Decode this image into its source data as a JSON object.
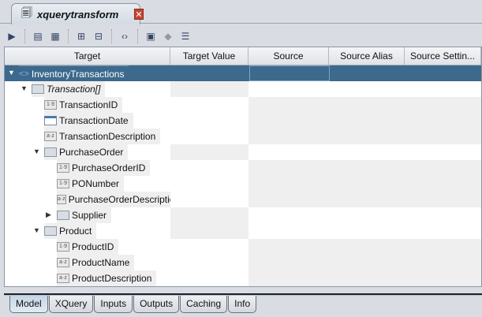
{
  "tab": {
    "title": "xquerytransform",
    "close": "✕"
  },
  "columns": [
    "Target",
    "Target Value",
    "Source",
    "Source Alias",
    "Source Settin..."
  ],
  "rows": [
    {
      "label": "InventoryTransactions",
      "icon": "<>",
      "level": 0,
      "expanded": true,
      "container": true,
      "selected": true
    },
    {
      "label": "Transaction[]",
      "icon": "box",
      "level": 1,
      "expanded": true,
      "container": true,
      "italic": true
    },
    {
      "label": "TransactionID",
      "icon": "1·9",
      "level": 2
    },
    {
      "label": "TransactionDate",
      "icon": "cal",
      "level": 2
    },
    {
      "label": "TransactionDescription",
      "icon": "a·z",
      "level": 2
    },
    {
      "label": "PurchaseOrder",
      "icon": "box",
      "level": 2,
      "expanded": true,
      "container": true
    },
    {
      "label": "PurchaseOrderID",
      "icon": "1·9",
      "level": 3
    },
    {
      "label": "PONumber",
      "icon": "1·9",
      "level": 3
    },
    {
      "label": "PurchaseOrderDescription",
      "icon": "a·z",
      "level": 3
    },
    {
      "label": "Supplier",
      "icon": "box",
      "level": 3,
      "expanded": false,
      "container": true
    },
    {
      "label": "Product",
      "icon": "box",
      "level": 2,
      "expanded": true,
      "container": true
    },
    {
      "label": "ProductID",
      "icon": "1·9",
      "level": 3
    },
    {
      "label": "ProductName",
      "icon": "a·z",
      "level": 3
    },
    {
      "label": "ProductDescription",
      "icon": "a·z",
      "level": 3
    }
  ],
  "bottom_tabs": [
    "Model",
    "XQuery",
    "Inputs",
    "Outputs",
    "Caching",
    "Info"
  ],
  "active_tab": "Model"
}
